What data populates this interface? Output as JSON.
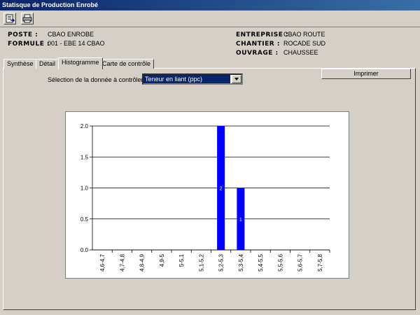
{
  "window": {
    "title": "Statisque de Production Enrobé"
  },
  "toolbar": {
    "icons": [
      "export-icon",
      "print-icon"
    ]
  },
  "info": {
    "poste_label": "POSTE :",
    "poste_value": "CBAO ENROBE",
    "formule_label": "FORMULE :",
    "formule_value": "001 - EBE 14 CBAO",
    "entreprise_label": "ENTREPRISE :",
    "entreprise_value": "CBAO ROUTE",
    "chantier_label": "CHANTIER :",
    "chantier_value": "ROCADE SUD",
    "ouvrage_label": "OUVRAGE :",
    "ouvrage_value": "CHAUSSEE"
  },
  "tabs": [
    {
      "label": "Synthèse"
    },
    {
      "label": "Détail"
    },
    {
      "label": "Histogramme",
      "active": true
    },
    {
      "label": "Carte de contrôle"
    }
  ],
  "selection": {
    "label": "Sélection de la donnée à contrôler :",
    "value": "Teneur en liant (ppc)"
  },
  "print_button": "Imprimer",
  "colors": {
    "bar": "#0000ff",
    "titlebar": "#0a246a"
  },
  "chart_data": {
    "type": "bar",
    "title": "",
    "xlabel": "",
    "ylabel": "",
    "categories": [
      "4,6-4,7",
      "4,7-4,8",
      "4,8-4,9",
      "4,9-5",
      "5-5,1",
      "5,1-5,2",
      "5,2-5,3",
      "5,3-5,4",
      "5,4-5,5",
      "5,5-5,6",
      "5,6-5,7",
      "5,7-5,8"
    ],
    "values": [
      0,
      0,
      0,
      0,
      0,
      0,
      2,
      1,
      0,
      0,
      0,
      0
    ],
    "data_labels": [
      "",
      "",
      "",
      "",
      "",
      "",
      "2",
      "1",
      "",
      "",
      "",
      ""
    ],
    "ylim": [
      0,
      2.0
    ],
    "yticks": [
      "0.0",
      "0.5",
      "1.0",
      "1.5",
      "2.0"
    ],
    "grid": true
  }
}
